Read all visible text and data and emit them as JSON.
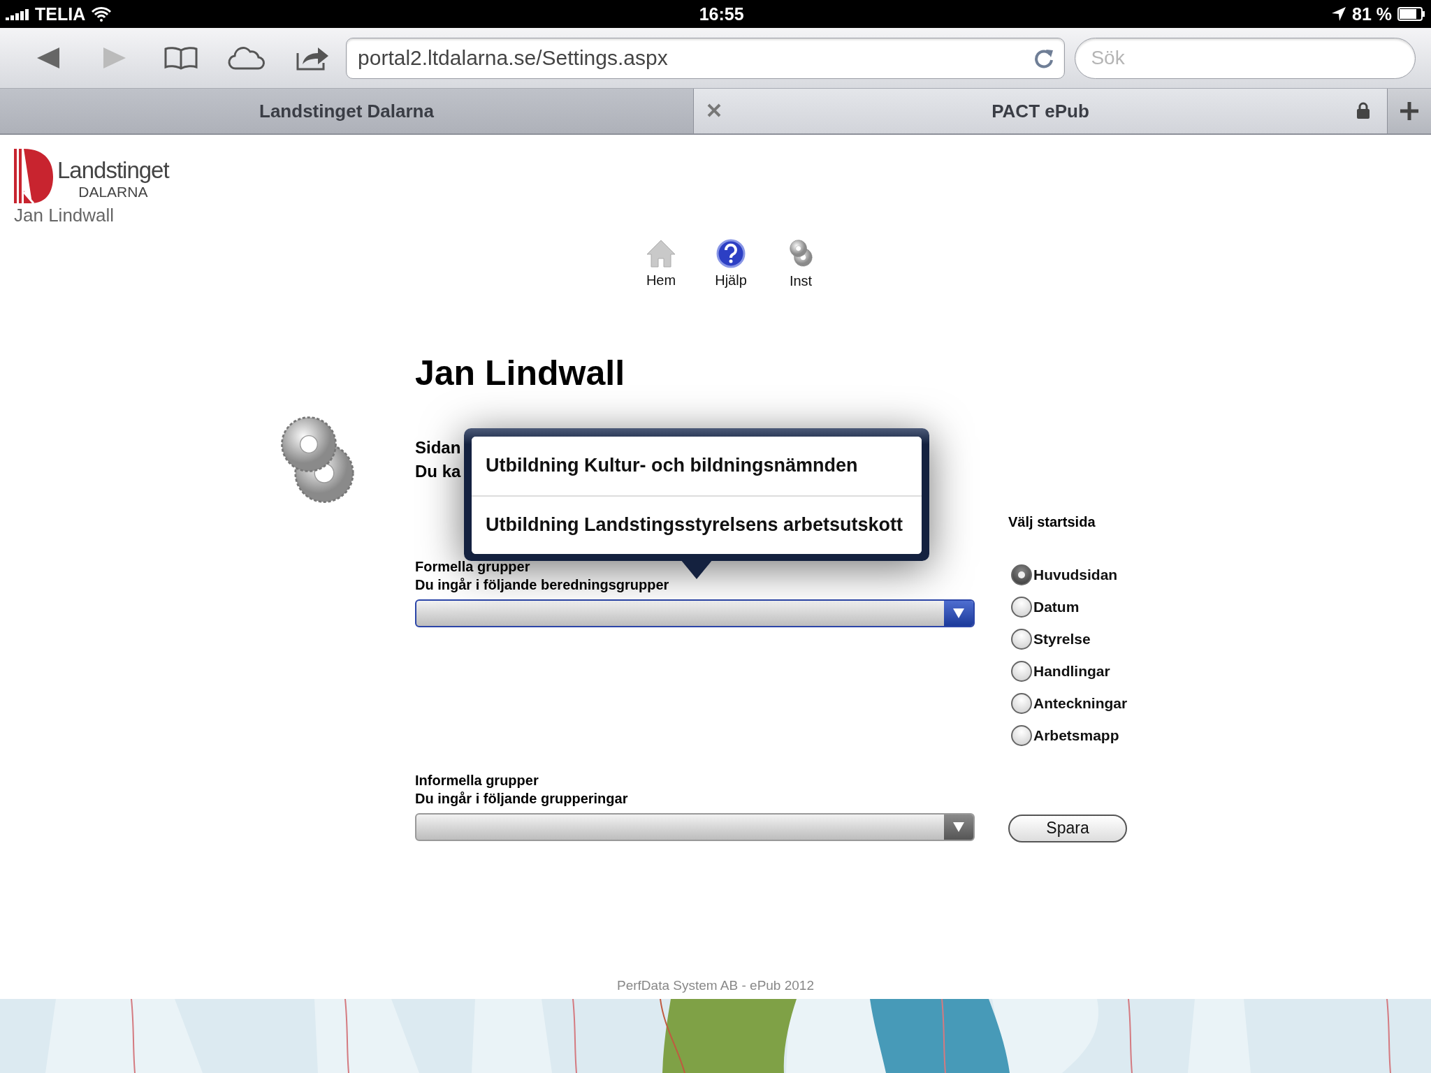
{
  "status_bar": {
    "carrier": "TELIA",
    "time": "16:55",
    "battery": "81 %"
  },
  "browser": {
    "url": "portal2.ltdalarna.se/Settings.aspx",
    "search_placeholder": "Sök"
  },
  "tabs": [
    {
      "title": "Landstinget Dalarna",
      "selected": false
    },
    {
      "title": "PACT ePub",
      "selected": true
    }
  ],
  "header": {
    "logo_line1": "Landstinget",
    "logo_line2": "DALARNA",
    "user": "Jan Lindwall"
  },
  "nav": [
    {
      "kind": "home",
      "label": "Hem"
    },
    {
      "kind": "help",
      "label": "Hjälp"
    },
    {
      "kind": "settings",
      "label": "Inst"
    }
  ],
  "title": "Jan Lindwall",
  "intro": [
    "Sidan",
    "Du ka"
  ],
  "groups": [
    {
      "heading": "Formella grupper",
      "subheading": "Du ingår i följande beredningsgrupper",
      "active": true
    },
    {
      "heading": "Informella grupper",
      "subheading": "Du ingår i följande grupperingar",
      "active": false
    }
  ],
  "popover": {
    "options": [
      "Utbildning Kultur- och bildningsnämnden",
      "Utbildning Landstingsstyrelsens arbetsutskott"
    ]
  },
  "start_page": {
    "heading": "Välj startsida",
    "options": [
      {
        "label": "Huvudsidan",
        "selected": true
      },
      {
        "label": "Datum",
        "selected": false
      },
      {
        "label": "Styrelse",
        "selected": false
      },
      {
        "label": "Handlingar",
        "selected": false
      },
      {
        "label": "Anteckningar",
        "selected": false
      },
      {
        "label": "Arbetsmapp",
        "selected": false
      }
    ]
  },
  "save_button": "Spara",
  "footer": "PerfData System AB - ePub 2012"
}
